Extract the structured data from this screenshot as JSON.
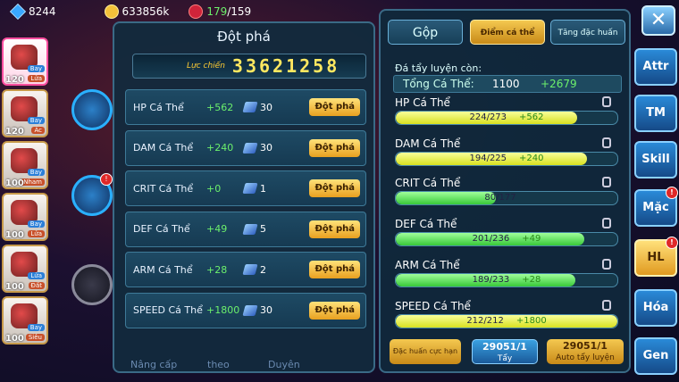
{
  "topbar": {
    "gems": "8244",
    "coins": "633856k",
    "fruit_current": "179",
    "fruit_max": "/159"
  },
  "roster": [
    {
      "level": "120",
      "tag1": "Bay",
      "tag2": "Lửa",
      "selected": true
    },
    {
      "level": "120",
      "tag1": "Bay",
      "tag2": "Ác",
      "selected": false
    },
    {
      "level": "100",
      "tag1": "Bay",
      "tag2": "Nham",
      "selected": false
    },
    {
      "level": "100",
      "tag1": "Bay",
      "tag2": "Lửa",
      "selected": false
    },
    {
      "level": "100",
      "tag1": "Lửa",
      "tag2": "Đất",
      "selected": false
    },
    {
      "level": "100",
      "tag1": "Bay",
      "tag2": "Siêu",
      "selected": false
    }
  ],
  "breakthrough": {
    "title": "Đột phá",
    "power_label": "Lực chiến",
    "power_value": "33621258",
    "button_label": "Đột phá",
    "rows": [
      {
        "name": "HP Cá Thể",
        "bonus": "+562",
        "count": "30"
      },
      {
        "name": "DAM Cá Thể",
        "bonus": "+240",
        "count": "30"
      },
      {
        "name": "CRIT Cá Thể",
        "bonus": "+0",
        "count": "1"
      },
      {
        "name": "DEF Cá Thể",
        "bonus": "+49",
        "count": "5"
      },
      {
        "name": "ARM Cá Thể",
        "bonus": "+28",
        "count": "2"
      },
      {
        "name": "SPEED Cá Thể",
        "bonus": "+1800",
        "count": "30"
      }
    ]
  },
  "bottom_faded": {
    "a": "Nâng cấp",
    "b": "theo",
    "c": "Duyên"
  },
  "right": {
    "tabs": {
      "merge": "Gộp",
      "individual": "Điểm cá thể",
      "special": "Tăng đặc huấn"
    },
    "remaining_label": "Đá tẩy luyện còn:",
    "total_label": "Tổng Cá Thể:",
    "total_value": "1100",
    "total_bonus": "+2679",
    "stats": [
      {
        "name": "HP Cá Thể",
        "current": 224,
        "max": 273,
        "text": "224/273",
        "bonus": "+562",
        "color": "y"
      },
      {
        "name": "DAM Cá Thể",
        "current": 194,
        "max": 225,
        "text": "194/225",
        "bonus": "+240",
        "color": "y"
      },
      {
        "name": "CRIT Cá Thể",
        "current": 80,
        "max": 177,
        "text": "80/177",
        "bonus": "",
        "color": "g"
      },
      {
        "name": "DEF Cá Thể",
        "current": 201,
        "max": 236,
        "text": "201/236",
        "bonus": "+49",
        "color": "g"
      },
      {
        "name": "ARM Cá Thể",
        "current": 189,
        "max": 233,
        "text": "189/233",
        "bonus": "+28",
        "color": "g"
      },
      {
        "name": "SPEED Cá Thể",
        "current": 212,
        "max": 212,
        "text": "212/212",
        "bonus": "+1800",
        "color": "y"
      }
    ],
    "buttons": {
      "special_train": "Đặc huấn cực hạn",
      "wash_count": "29051/1",
      "wash_label": "Tẩy",
      "auto_count": "29051/1",
      "auto_label": "Auto tẩy luyện"
    }
  },
  "side_menu": [
    "Attr",
    "TM",
    "Skill",
    "Mặc",
    "HL",
    "Hóa",
    "Gen"
  ],
  "side_active": "HL",
  "close_label": "✕"
}
